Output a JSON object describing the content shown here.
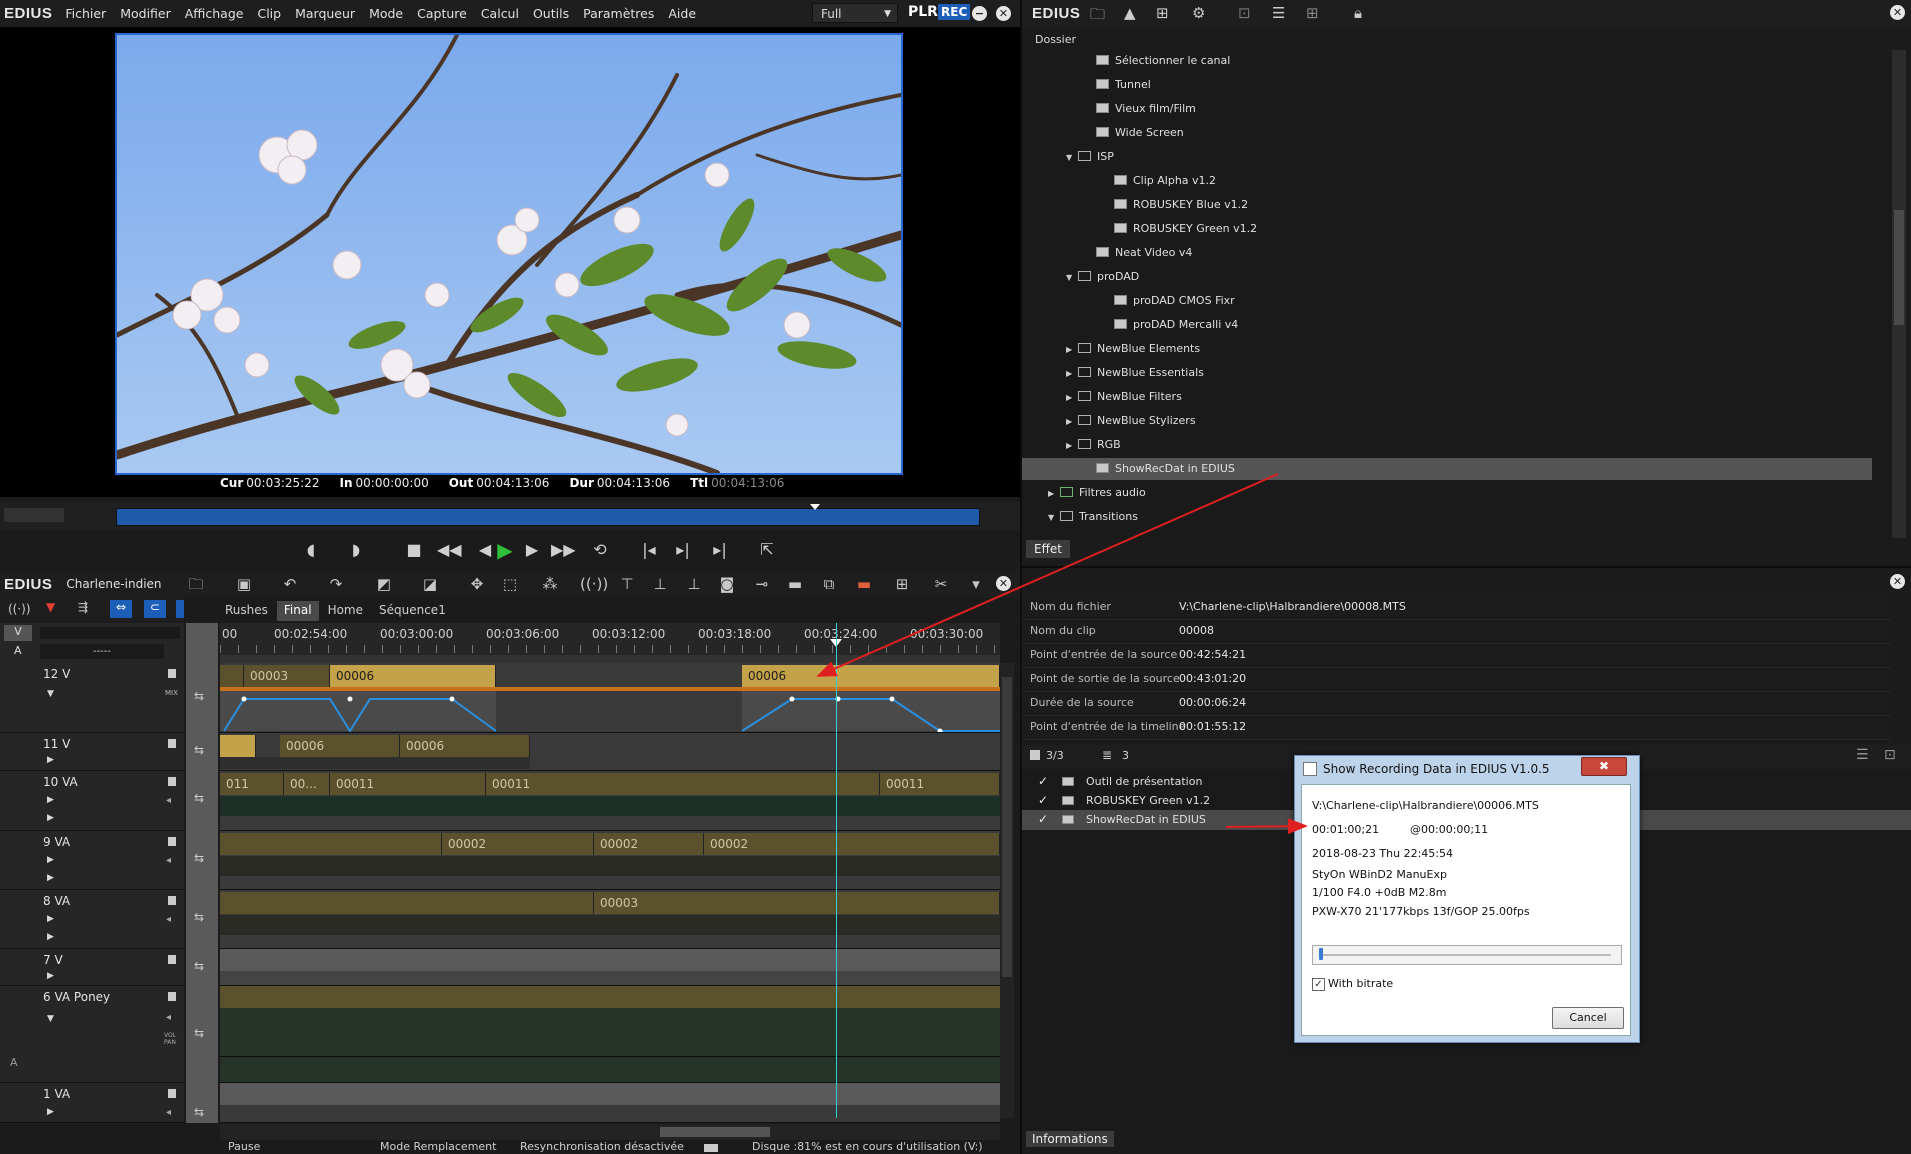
{
  "app": {
    "logo": "EDIUS"
  },
  "menu": [
    "Fichier",
    "Modifier",
    "Affichage",
    "Clip",
    "Marqueur",
    "Mode",
    "Capture",
    "Calcul",
    "Outils",
    "Paramètres",
    "Aide"
  ],
  "player": {
    "view_mode": "Full",
    "plr_label": "PLR",
    "rec_label": "REC",
    "timecodes": [
      {
        "label": "Cur",
        "value": "00:03:25:22"
      },
      {
        "label": "In",
        "value": "00:00:00:00"
      },
      {
        "label": "Out",
        "value": "00:04:13:06"
      },
      {
        "label": "Dur",
        "value": "00:04:13:06"
      },
      {
        "label": "Ttl",
        "value": "00:04:13:06"
      }
    ]
  },
  "timeline": {
    "project_name": "Charlene-indien",
    "tabs": [
      "Rushes",
      "Final",
      "Home",
      "Séquence1"
    ],
    "active_tab": "Final",
    "ruler": [
      "00",
      "00:02:54:00",
      "00:03:00:00",
      "00:03:06:00",
      "00:03:12:00",
      "00:03:18:00",
      "00:03:24:00",
      "00:03:30:00"
    ],
    "vid_label": "V",
    "aud_label": "A",
    "aud_select": "-----",
    "tracks": [
      {
        "name": "12 V",
        "clips": [
          "00003",
          "00006",
          "00006"
        ]
      },
      {
        "name": "11 V",
        "clips": [
          "00006",
          "00006"
        ]
      },
      {
        "name": "10 VA",
        "clips": [
          "011",
          "00...",
          "00011",
          "00011",
          "00011"
        ]
      },
      {
        "name": "9 VA",
        "clips": [
          "00002",
          "00002",
          "00002"
        ]
      },
      {
        "name": "8 VA",
        "clips": [
          "00003"
        ]
      },
      {
        "name": "7 V",
        "clips": []
      },
      {
        "name": "6 VA Poney",
        "clips": []
      },
      {
        "name": "1 VA",
        "clips": []
      }
    ],
    "mix_label": "MIX",
    "vol_label": "VOL PAN",
    "a2_label": "A"
  },
  "status": {
    "state": "Pause",
    "mode": "Mode Remplacement",
    "resync": "Resynchronisation désactivée",
    "disk": "Disque :81% est en cours d'utilisation (V:)"
  },
  "effects_panel": {
    "logo": "EDIUS",
    "folder_label": "Dossier",
    "tab": "Effet",
    "items": [
      {
        "label": "Sélectionner le canal",
        "indent": 3,
        "icon": "fx",
        "tw": ""
      },
      {
        "label": "Tunnel",
        "indent": 3,
        "icon": "fx",
        "tw": ""
      },
      {
        "label": "Vieux film/Film",
        "indent": 3,
        "icon": "fx",
        "tw": ""
      },
      {
        "label": "Wide Screen",
        "indent": 3,
        "icon": "fx",
        "tw": ""
      },
      {
        "label": "ISP",
        "indent": 2,
        "icon": "folder",
        "tw": "▼"
      },
      {
        "label": "Clip Alpha v1.2",
        "indent": 4,
        "icon": "fx",
        "tw": ""
      },
      {
        "label": "ROBUSKEY Blue v1.2",
        "indent": 4,
        "icon": "fx",
        "tw": ""
      },
      {
        "label": "ROBUSKEY Green v1.2",
        "indent": 4,
        "icon": "fx",
        "tw": ""
      },
      {
        "label": "Neat Video v4",
        "indent": 3,
        "icon": "fx",
        "tw": ""
      },
      {
        "label": "proDAD",
        "indent": 2,
        "icon": "folder",
        "tw": "▼"
      },
      {
        "label": "proDAD CMOS Fixr",
        "indent": 4,
        "icon": "fx",
        "tw": ""
      },
      {
        "label": "proDAD Mercalli v4",
        "indent": 4,
        "icon": "fx",
        "tw": ""
      },
      {
        "label": "NewBlue Elements",
        "indent": 2,
        "icon": "folder",
        "tw": "▶"
      },
      {
        "label": "NewBlue Essentials",
        "indent": 2,
        "icon": "folder",
        "tw": "▶"
      },
      {
        "label": "NewBlue Filters",
        "indent": 2,
        "icon": "folder",
        "tw": "▶"
      },
      {
        "label": "NewBlue Stylizers",
        "indent": 2,
        "icon": "folder",
        "tw": "▶"
      },
      {
        "label": "RGB",
        "indent": 2,
        "icon": "folder",
        "tw": "▶"
      },
      {
        "label": "ShowRecDat in EDIUS",
        "indent": 3,
        "icon": "fx",
        "tw": "",
        "selected": true
      },
      {
        "label": "Filtres audio",
        "indent": 1,
        "icon": "audio",
        "tw": "▶"
      },
      {
        "label": "Transitions",
        "indent": 1,
        "icon": "folder",
        "tw": "▼"
      }
    ]
  },
  "info_panel": {
    "rows": [
      {
        "k": "Nom du fichier",
        "v": "V:\\Charlene-clip\\Halbrandiere\\00008.MTS"
      },
      {
        "k": "Nom du clip",
        "v": "00008"
      },
      {
        "k": "Point d'entrée de la source",
        "v": "00:42:54:21"
      },
      {
        "k": "Point de sortie de la source",
        "v": "00:43:01:20"
      },
      {
        "k": "Durée de la source",
        "v": "00:00:06:24"
      },
      {
        "k": "Point d'entrée de la timeline",
        "v": "00:01:55:12"
      }
    ],
    "count": "3/3",
    "count2": "3",
    "effects": [
      {
        "label": "Outil de présentation",
        "checked": true
      },
      {
        "label": "ROBUSKEY Green v1.2",
        "checked": true
      },
      {
        "label": "ShowRecDat in EDIUS",
        "checked": true,
        "selected": true
      }
    ],
    "tab": "Informations"
  },
  "dialog": {
    "title": "Show Recording Data in EDIUS V1.0.5",
    "file": "V:\\Charlene-clip\\Halbrandiere\\00006.MTS",
    "tc1": "00:01:00;21",
    "tc2": "@00:00:00;11",
    "date": "2018-08-23  Thu 22:45:54",
    "line3": "StyOn  WBinD2  ManuExp",
    "line4": "1/100 F4.0 +0dB M2.8m",
    "line5": "PXW-X70    21'177kbps 13f/GOP  25.00fps",
    "with_bitrate": "With bitrate",
    "cancel": "Cancel",
    "close": "✖"
  },
  "colors": {
    "accent": "#1d5fb8",
    "clip": "#c4a24a",
    "playhead": "#33d0d0",
    "arrow": "#e02020"
  }
}
